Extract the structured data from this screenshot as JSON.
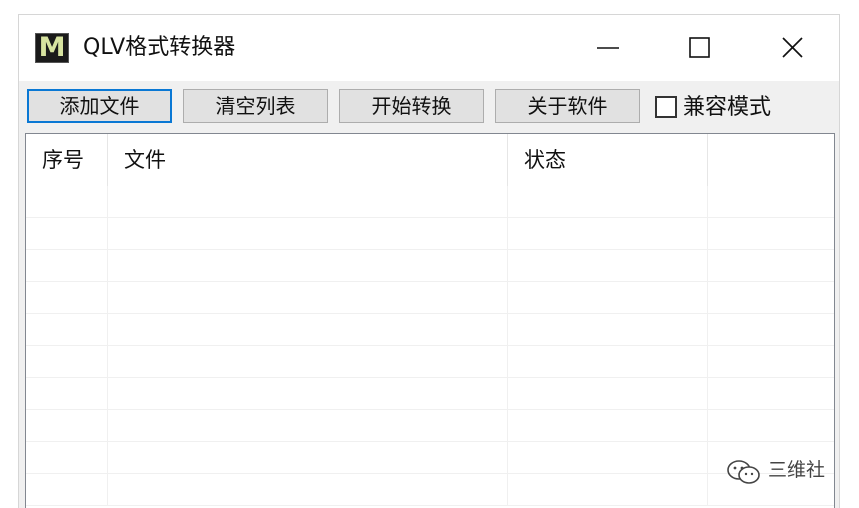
{
  "window": {
    "title": "QLV格式转换器",
    "icon_letter": "M",
    "controls": [
      "minimize-icon",
      "maximize-icon",
      "close-icon"
    ]
  },
  "toolbar": {
    "add_files_label": "添加文件",
    "clear_list_label": "清空列表",
    "start_convert_label": "开始转换",
    "about_label": "关于软件",
    "compat_mode_label": "兼容模式",
    "compat_mode_checked": false
  },
  "list": {
    "columns": [
      "序号",
      "文件",
      "状态",
      ""
    ],
    "rows": []
  },
  "watermark": {
    "text": "三维社",
    "icon": "wechat-icon"
  },
  "colors": {
    "accent": "#0a78d4",
    "window_bg": "#f0f0f0"
  }
}
